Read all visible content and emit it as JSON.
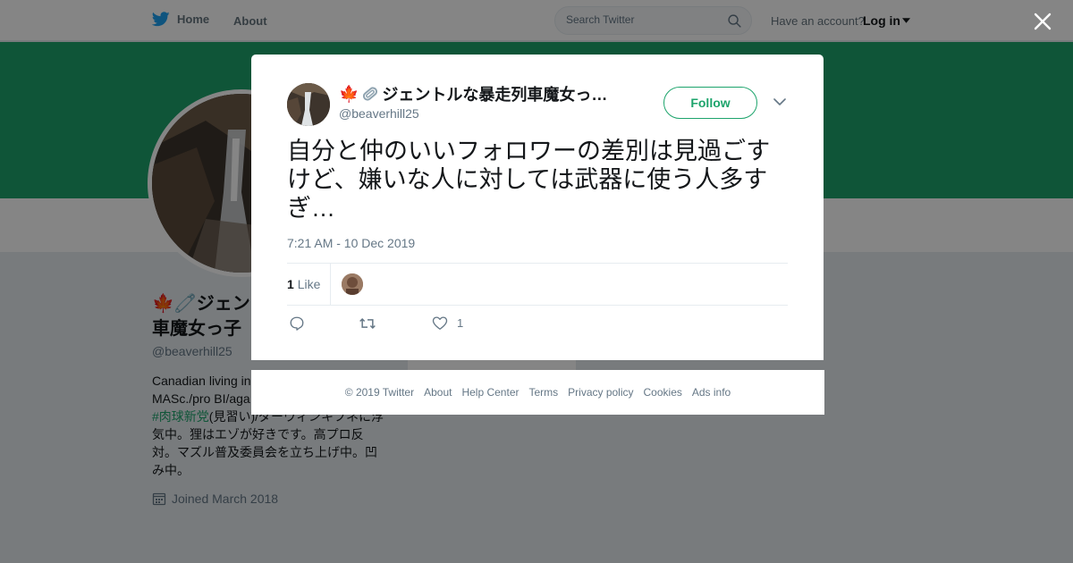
{
  "nav": {
    "home_label": "Home",
    "about_label": "About",
    "search_placeholder": "Search Twitter",
    "have_account": "Have an account?",
    "login_label": "Log in"
  },
  "profile": {
    "name_line1": "🍁🧷ジェン",
    "name_line2": "車魔女っ子",
    "handle": "@beaverhill25",
    "bio_line1": "Canadian living in",
    "bio_line2": "MASc./pro BI/aga",
    "bio_hashtag": "#肉球新党",
    "bio_after_hashtag": "(見習い)/ダーウィンキフネに浮",
    "bio_line4": "気中。狸はエゾが好きです。高プロ反",
    "bio_line5": "対。マズル普及委員会を立ち上げ中。凹",
    "bio_line6": "み中。",
    "joined": "Joined March 2018"
  },
  "tweet": {
    "author_name": "ジェントルな暴走列車魔女っ…",
    "author_emoji": "🍁",
    "author_handle": "@beaverhill25",
    "follow_label": "Follow",
    "text": "自分と仲のいいフォロワーの差別は見過ごすけど、嫌いな人に対しては武器に使う人多すぎ…",
    "timestamp": "7:21 AM - 10 Dec 2019",
    "like_count": "1",
    "like_label": "Like",
    "action_like_count": "1"
  },
  "footer": {
    "copyright": "© 2019 Twitter",
    "links": [
      "About",
      "Help Center",
      "Terms",
      "Privacy policy",
      "Cookies",
      "Ads info"
    ]
  },
  "colors": {
    "banner": "#1da46c",
    "accent": "#1da46c",
    "twitter_blue": "#1da1f2",
    "text_secondary": "#657786"
  },
  "icons": [
    "twitter-bird-icon",
    "search-icon",
    "caret-down-icon",
    "close-icon",
    "calendar-icon",
    "reply-icon",
    "retweet-icon",
    "heart-icon",
    "paperclip-icon"
  ]
}
